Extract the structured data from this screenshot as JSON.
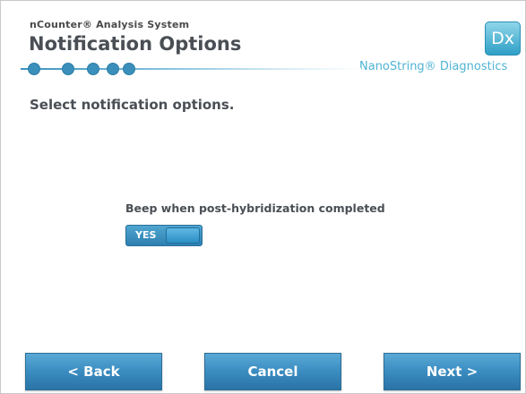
{
  "header": {
    "system_name": "nCounter® Analysis System",
    "title": "Notification Options",
    "logo_text": "Dx",
    "brand": "NanoString® Diagnostics"
  },
  "progress": {
    "total_steps": 5,
    "current_step": 5
  },
  "main": {
    "instruction": "Select notification options.",
    "option": {
      "label": "Beep when post-hybridization completed",
      "toggle_text": "YES",
      "value": true
    }
  },
  "footer": {
    "back_label": "<  Back",
    "cancel_label": "Cancel",
    "next_label": "Next  >"
  },
  "colors": {
    "accent": "#3a8cc0",
    "brand": "#4fb3d3",
    "title_text": "#4a4f55"
  }
}
